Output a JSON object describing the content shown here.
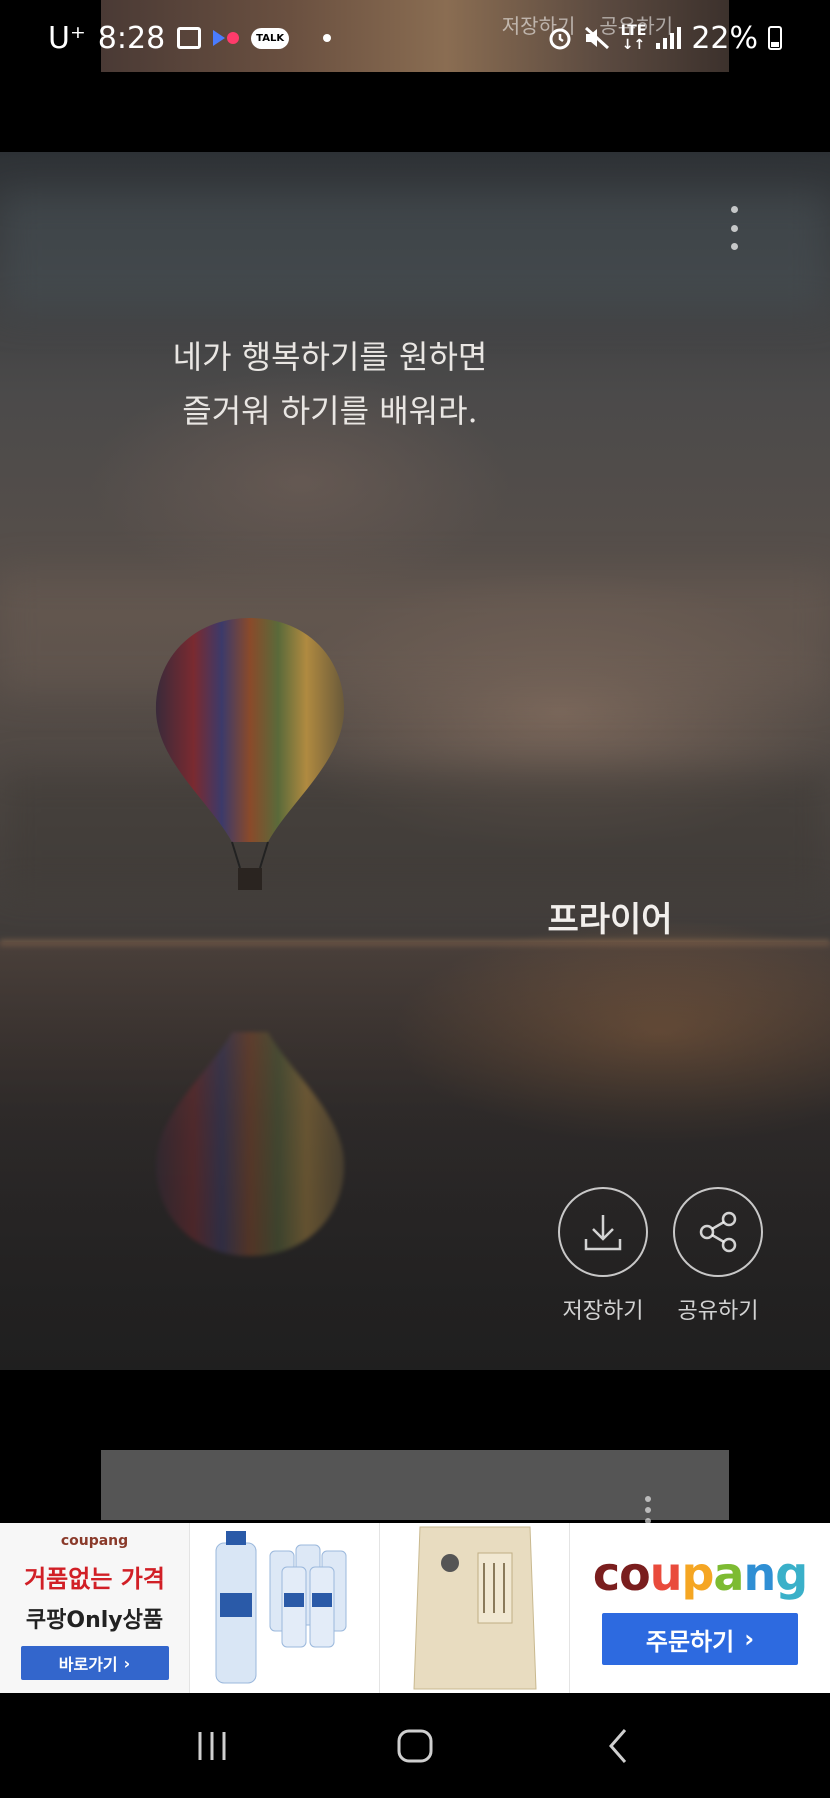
{
  "status_bar": {
    "carrier": "U⁺",
    "time": "8:28",
    "lte": "LTE",
    "battery": "22%"
  },
  "previous_card": {
    "save_label": "저장하기",
    "share_label": "공유하기"
  },
  "quote_card": {
    "line1": "네가 행복하기를 원하면",
    "line2": "즐거워 하기를 배워라.",
    "author": "프라이어",
    "save_label": "저장하기",
    "share_label": "공유하기"
  },
  "ad": {
    "tile1_brand": "coupang",
    "tile1_headline": "거품없는 가격",
    "tile1_sub": "쿠팡Only상품",
    "tile1_button": "바로가기",
    "logo": [
      "c",
      "o",
      "u",
      "p",
      "a",
      "n",
      "g"
    ],
    "order_button": "주문하기"
  },
  "colors": {
    "ad_button_blue": "#2d6ae0",
    "ad_red": "#d11f26"
  },
  "icons": {
    "nav_recent": "recent-apps-icon",
    "nav_home": "home-icon",
    "nav_back": "back-icon"
  }
}
